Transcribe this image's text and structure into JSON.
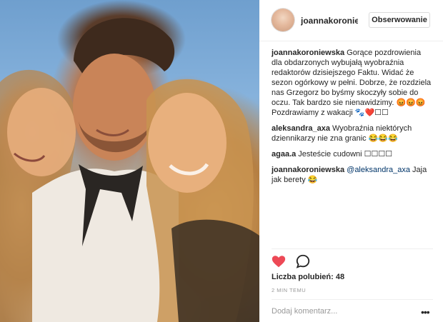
{
  "header": {
    "username": "joannakoroniewska",
    "follow_label": "Obserwowanie"
  },
  "comments": [
    {
      "user": "joannakoroniewska",
      "text": " Gorące pozdrowienia dla obdarzonych wybujałą wyobraźnia redaktorów dzisiejszego Faktu. Widać że sezon ogórkowy w pełni. Dobrze, że rozdziela nas Grzegorz bo byśmy skoczyły sobie do oczu. Tak bardzo sie nienawidzimy. 😡😡😡 Pozdrawiamy z wakacji 🐾❤️☐☐"
    },
    {
      "user": "aleksandra_axa",
      "text": " Wyobraźnia niektórych dziennikarzy nie zna granic 😂😂😂"
    },
    {
      "user": "agaa.a",
      "text": " Jesteście cudowni ☐☐☐☐"
    },
    {
      "user": "joannakoroniewska",
      "mention": " @aleksandra_axa",
      "text": " Jaja jak berety 😂"
    }
  ],
  "actions": {
    "like_icon": "heart-filled-icon",
    "comment_icon": "comment-bubble-icon",
    "like_color": "#ed4956"
  },
  "likes_text": "Liczba polubień: 48",
  "time_text": "2 MIN TEMU",
  "add_comment_placeholder": "Dodaj komentarz...",
  "more_label": "•••"
}
